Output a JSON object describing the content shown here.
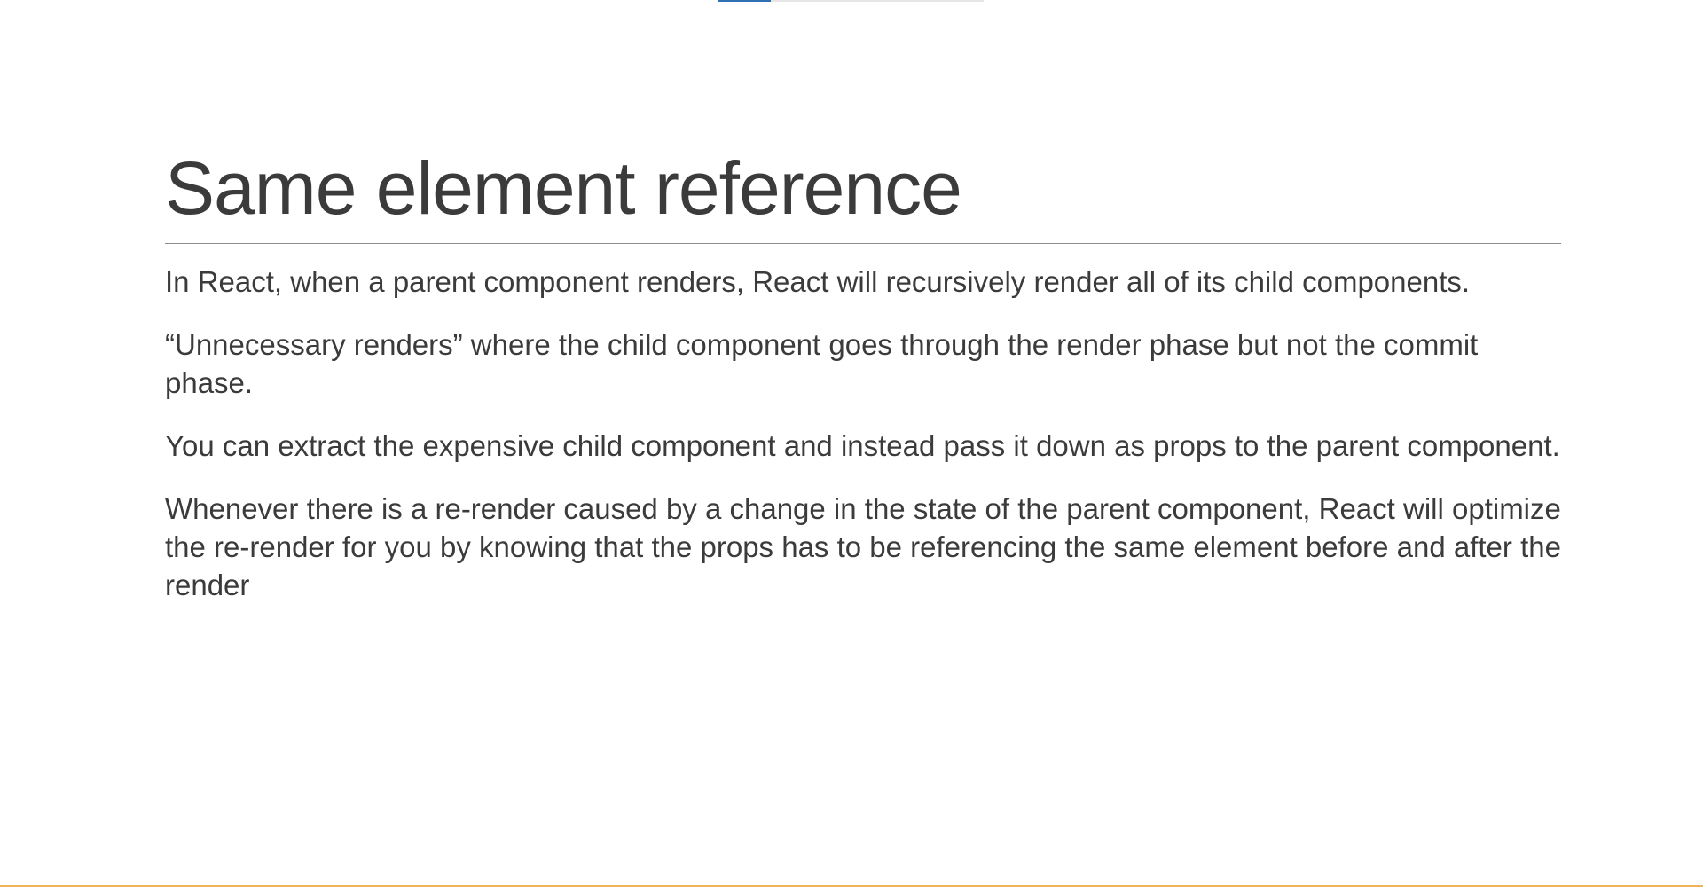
{
  "slide": {
    "progress_fraction": 0.2,
    "title": "Same element reference",
    "paragraphs": [
      "In React, when a parent component renders, React will recursively render all of its child components.",
      "“Unnecessary renders” where the child component goes through the render phase but not the commit phase.",
      "You can extract the expensive child component and instead pass it down as props to the parent component.",
      "Whenever there is a re-render caused by a change in the state of the parent component, React will optimize the re-render for you by knowing that the props has to be referencing the same element before and after the render"
    ]
  },
  "colors": {
    "text": "#3b3b3b",
    "title_rule": "#8c8c8c",
    "progress_fill": "#2f6fb3",
    "bottom_accent": "#f0b35a"
  }
}
